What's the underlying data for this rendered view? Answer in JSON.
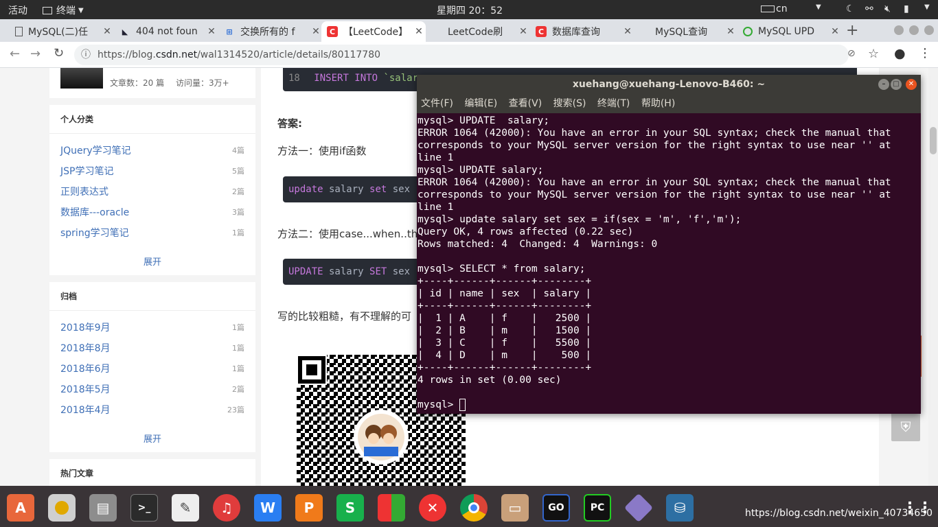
{
  "topbar": {
    "activities": "活动",
    "app_name": "终端",
    "clock": "星期四 20：52",
    "input_method": "cn"
  },
  "tabs": [
    {
      "label": "MySQL(二)任",
      "icon": "doc-icon"
    },
    {
      "label": "404 not foun",
      "icon": "ghost-icon"
    },
    {
      "label": "交换所有的 f",
      "icon": "site-icon"
    },
    {
      "label": "【LeetCode】",
      "icon": "csdn-icon"
    },
    {
      "label": "LeetCode刷",
      "icon": "leetcode-icon"
    },
    {
      "label": "数据库查询",
      "icon": "csdn-icon"
    },
    {
      "label": "MySQL查询",
      "icon": "leetcode-icon"
    },
    {
      "label": "MySQL UPD",
      "icon": "site-icon"
    }
  ],
  "address": {
    "prefix": "https://blog.",
    "host": "csdn.net",
    "path": "/wal1314520/article/details/80117780"
  },
  "profile": {
    "articles": "文章数：20 篇",
    "visits": "访问量：3万+"
  },
  "categories": {
    "title": "个人分类",
    "items": [
      {
        "name": "JQuery学习笔记",
        "count": "4篇"
      },
      {
        "name": "JSP学习笔记",
        "count": "5篇"
      },
      {
        "name": "正则表达式",
        "count": "2篇"
      },
      {
        "name": "数据库---oracle",
        "count": "3篇"
      },
      {
        "name": "spring学习笔记",
        "count": "1篇"
      }
    ],
    "more": "展开"
  },
  "archive": {
    "title": "归档",
    "items": [
      {
        "name": "2018年9月",
        "count": "1篇"
      },
      {
        "name": "2018年8月",
        "count": "1篇"
      },
      {
        "name": "2018年6月",
        "count": "1篇"
      },
      {
        "name": "2018年5月",
        "count": "2篇"
      },
      {
        "name": "2018年4月",
        "count": "23篇"
      }
    ],
    "more": "展开"
  },
  "hot": {
    "title": "热门文章"
  },
  "article": {
    "code_top_line": "18",
    "code_top_kw": "INSERT INTO",
    "code_top_rest": " `salary",
    "answer": "答案:",
    "method1": "方法一：使用if函数",
    "code1_kw": "update",
    "code1_rest": " salary ",
    "code1_kw2": "set",
    "code1_rest2": " sex",
    "method2": "方法二：使用case...when..th",
    "code2_kw": "UPDATE",
    "code2_rest": " salary ",
    "code2_kw2": "SET",
    "code2_rest2": " sex",
    "closing": "写的比较粗糙，有不理解的可"
  },
  "terminal": {
    "title": "xuehang@xuehang-Lenovo-B460: ~",
    "menu": [
      "文件(F)",
      "编辑(E)",
      "查看(V)",
      "搜索(S)",
      "终端(T)",
      "帮助(H)"
    ],
    "output": "mysql> UPDATE  salary;\nERROR 1064 (42000): You have an error in your SQL syntax; check the manual that\ncorresponds to your MySQL server version for the right syntax to use near '' at\nline 1\nmysql> UPDATE salary;\nERROR 1064 (42000): You have an error in your SQL syntax; check the manual that\ncorresponds to your MySQL server version for the right syntax to use near '' at\nline 1\nmysql> update salary set sex = if(sex = 'm', 'f','m');\nQuery OK, 4 rows affected (0.22 sec)\nRows matched: 4  Changed: 4  Warnings: 0\n\nmysql> SELECT * from salary;\n+----+------+------+--------+\n| id | name | sex  | salary |\n+----+------+------+--------+\n|  1 | A    | f    |   2500 |\n|  2 | B    | m    |   1500 |\n|  3 | C    | f    |   5500 |\n|  4 | D    | m    |    500 |\n+----+------+------+--------+\n4 rows in set (0.00 sec)\n\n",
    "prompt": "mysql> "
  },
  "dock_icons": [
    "software-center-icon",
    "rhythmbox-icon",
    "files-icon",
    "terminal-icon",
    "text-editor-icon",
    "netease-music-icon",
    "wps-writer-icon",
    "wps-presentation-icon",
    "wps-spreadsheet-icon",
    "office-icon",
    "close-app-icon",
    "chrome-icon",
    "file-manager-icon",
    "goland-icon",
    "pycharm-icon",
    "vs-icon",
    "mysql-workbench-icon",
    "app-grid-icon"
  ],
  "watermark": "https://blog.csdn.net/weixin_40734650"
}
